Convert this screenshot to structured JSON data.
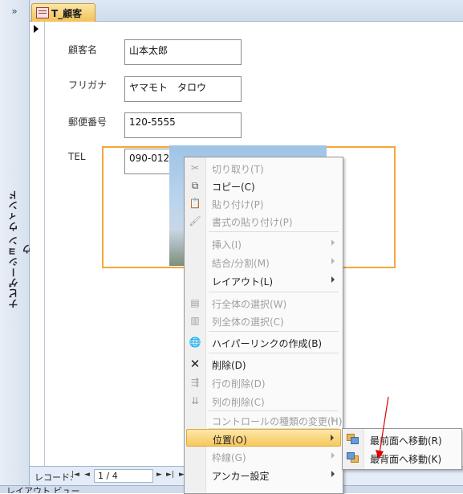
{
  "nav": {
    "toggle": "»",
    "title": "ナビゲーション ウィンドウ"
  },
  "tab": {
    "label": "T_顧客",
    "icon": "form-icon"
  },
  "form": {
    "fields": [
      {
        "label": "顧客名",
        "value": "山本太郎"
      },
      {
        "label": "フリガナ",
        "value": "ヤマモト　タロウ"
      },
      {
        "label": "郵便番号",
        "value": "120-5555"
      },
      {
        "label": "TEL",
        "value": "090-012"
      }
    ]
  },
  "record_nav": {
    "label": "レコード:",
    "first": "|◄",
    "prev": "◄",
    "current": "1 / 4",
    "next": "►",
    "last": "►|",
    "new": "►✱"
  },
  "status": {
    "view": "レイアウト ビュー"
  },
  "context_menu": {
    "items": [
      {
        "label": "切り取り(T)",
        "icon": "cut-icon",
        "glyph": "✂",
        "enabled": false
      },
      {
        "label": "コピー(C)",
        "icon": "copy-icon",
        "glyph": "⧉",
        "enabled": true
      },
      {
        "label": "貼り付け(P)",
        "icon": "paste-icon",
        "glyph": "📋",
        "enabled": false
      },
      {
        "label": "書式の貼り付け(P)",
        "icon": "format-paste-icon",
        "glyph": "🖌",
        "enabled": false
      },
      {
        "label": "挿入(I)",
        "enabled": false,
        "submenu": true
      },
      {
        "label": "結合/分割(M)",
        "enabled": false,
        "submenu": true
      },
      {
        "label": "レイアウト(L)",
        "enabled": true,
        "submenu": true
      },
      {
        "label": "行全体の選択(W)",
        "icon": "select-row-icon",
        "glyph": "▤",
        "enabled": false
      },
      {
        "label": "列全体の選択(C)",
        "icon": "select-column-icon",
        "glyph": "▥",
        "enabled": false
      },
      {
        "label": "ハイパーリンクの作成(B)",
        "icon": "hyperlink-icon",
        "glyph": "🌐",
        "enabled": true
      },
      {
        "label": "削除(D)",
        "icon": "delete-icon",
        "glyph": "✕",
        "enabled": true
      },
      {
        "label": "行の削除(D)",
        "icon": "delete-row-icon",
        "glyph": "⇶",
        "enabled": false
      },
      {
        "label": "列の削除(C)",
        "icon": "delete-column-icon",
        "glyph": "⇊",
        "enabled": false
      },
      {
        "label": "コントロールの種類の変更(H)",
        "enabled": false,
        "submenu": true
      },
      {
        "label": "位置(O)",
        "enabled": true,
        "submenu": true,
        "highlighted": true
      },
      {
        "label": "枠線(G)",
        "enabled": false,
        "submenu": true
      },
      {
        "label": "アンカー設定",
        "enabled": true,
        "submenu": true
      }
    ]
  },
  "position_submenu": {
    "items": [
      {
        "label": "最前面へ移動(R)",
        "icon": "bring-to-front-icon"
      },
      {
        "label": "最背面へ移動(K)",
        "icon": "send-to-back-icon"
      }
    ]
  },
  "colors": {
    "selection": "#f5a63a",
    "highlight": "#f7c75e",
    "tab": "#f3c15a"
  }
}
